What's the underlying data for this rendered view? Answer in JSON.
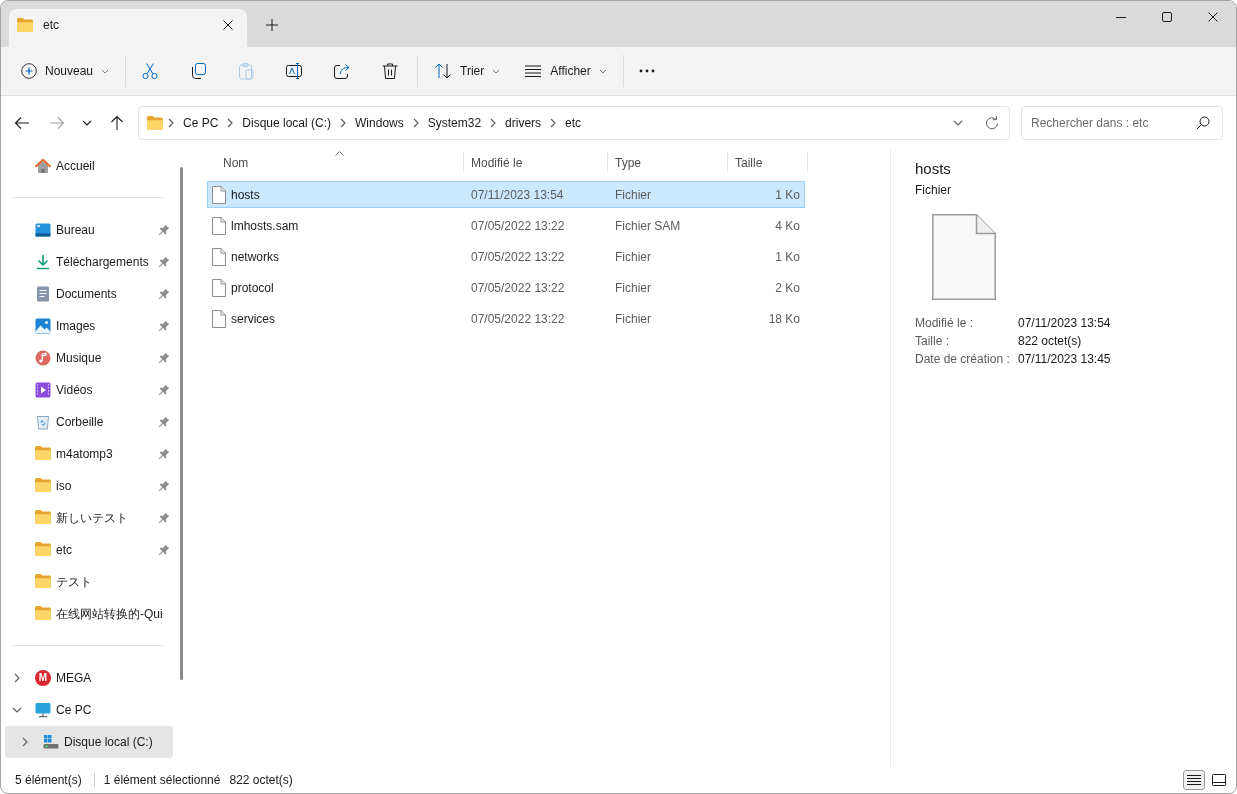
{
  "tabs": [
    {
      "label": "etc",
      "selected": true
    }
  ],
  "toolbar": {
    "new_label": "Nouveau",
    "actions": [
      {
        "kind": "cut",
        "disabled": false
      },
      {
        "kind": "copy",
        "disabled": false
      },
      {
        "kind": "paste",
        "disabled": true
      },
      {
        "kind": "rename",
        "disabled": false
      },
      {
        "kind": "share",
        "disabled": false
      },
      {
        "kind": "delete",
        "disabled": false
      }
    ],
    "sort_label": "Trier",
    "view_label": "Afficher"
  },
  "nav_buttons": [
    {
      "kind": "back",
      "disabled": false
    },
    {
      "kind": "forward",
      "disabled": true
    },
    {
      "kind": "recent",
      "disabled": false
    },
    {
      "kind": "up",
      "disabled": false
    }
  ],
  "address_bar": {
    "breadcrumbs": [
      "Ce PC",
      "Disque local (C:)",
      "Windows",
      "System32",
      "drivers",
      "etc"
    ]
  },
  "search": {
    "placeholder": "Rechercher dans : etc"
  },
  "sidebar": {
    "sections": [
      {
        "items": [
          {
            "label": "Accueil",
            "kind": "home",
            "pinned": false,
            "selected": false
          }
        ]
      },
      {
        "items": [
          {
            "label": "Bureau",
            "kind": "desktop",
            "pinned": true,
            "selected": false
          },
          {
            "label": "Téléchargements",
            "kind": "downloads",
            "pinned": true,
            "selected": false
          },
          {
            "label": "Documents",
            "kind": "documents",
            "pinned": true,
            "selected": false
          },
          {
            "label": "Images",
            "kind": "pictures",
            "pinned": true,
            "selected": false
          },
          {
            "label": "Musique",
            "kind": "music",
            "pinned": true,
            "selected": false
          },
          {
            "label": "Vidéos",
            "kind": "videos",
            "pinned": true,
            "selected": false
          },
          {
            "label": "Corbeille",
            "kind": "recycle_bin",
            "pinned": true,
            "selected": false
          },
          {
            "label": "m4atomp3",
            "kind": "folder",
            "pinned": true,
            "selected": false
          },
          {
            "label": "iso",
            "kind": "folder",
            "pinned": true,
            "selected": false
          },
          {
            "label": "新しいテスト",
            "kind": "folder",
            "pinned": true,
            "selected": false
          },
          {
            "label": "etc",
            "kind": "folder",
            "pinned": true,
            "selected": false
          },
          {
            "label": "テスト",
            "kind": "folder",
            "pinned": false,
            "selected": false
          },
          {
            "label": "在线网站转换的-Qui",
            "kind": "folder",
            "pinned": false,
            "selected": false
          }
        ]
      },
      {
        "items": [
          {
            "label": "MEGA",
            "kind": "logo",
            "logo_text": "M",
            "expanded": false,
            "selected": false
          },
          {
            "label": "Ce PC",
            "kind": "computer",
            "expanded": true,
            "selected": false,
            "children": [
              {
                "label": "Disque local (C:)",
                "kind": "drive",
                "expanded": false,
                "selected": true
              }
            ]
          }
        ]
      }
    ]
  },
  "files": {
    "columns": [
      {
        "label": "Nom",
        "sorted": true
      },
      {
        "label": "Modifié le",
        "sorted": false
      },
      {
        "label": "Type",
        "sorted": false
      },
      {
        "label": "Taille",
        "sorted": false
      }
    ],
    "rows": [
      {
        "name": "hosts",
        "modified": "07/11/2023 13:54",
        "type": "Fichier",
        "size": "1 Ko",
        "selected": true
      },
      {
        "name": "lmhosts.sam",
        "modified": "07/05/2022 13:22",
        "type": "Fichier SAM",
        "size": "4 Ko",
        "selected": false
      },
      {
        "name": "networks",
        "modified": "07/05/2022 13:22",
        "type": "Fichier",
        "size": "1 Ko",
        "selected": false
      },
      {
        "name": "protocol",
        "modified": "07/05/2022 13:22",
        "type": "Fichier",
        "size": "2 Ko",
        "selected": false
      },
      {
        "name": "services",
        "modified": "07/05/2022 13:22",
        "type": "Fichier",
        "size": "18 Ko",
        "selected": false
      }
    ]
  },
  "details": {
    "title": "hosts",
    "type": "Fichier",
    "properties": [
      {
        "label": "Modifié le :",
        "value": "07/11/2023 13:54"
      },
      {
        "label": "Taille :",
        "value": "822 octet(s)"
      },
      {
        "label": "Date de création :",
        "value": "07/11/2023 13:45"
      }
    ]
  },
  "status_bar": {
    "item_count": "5 élément(s)",
    "selection": "1 élément sélectionné",
    "selection_size": "822 octet(s)",
    "views": [
      {
        "kind": "details",
        "selected": true
      },
      {
        "kind": "tiles",
        "selected": false
      }
    ]
  }
}
